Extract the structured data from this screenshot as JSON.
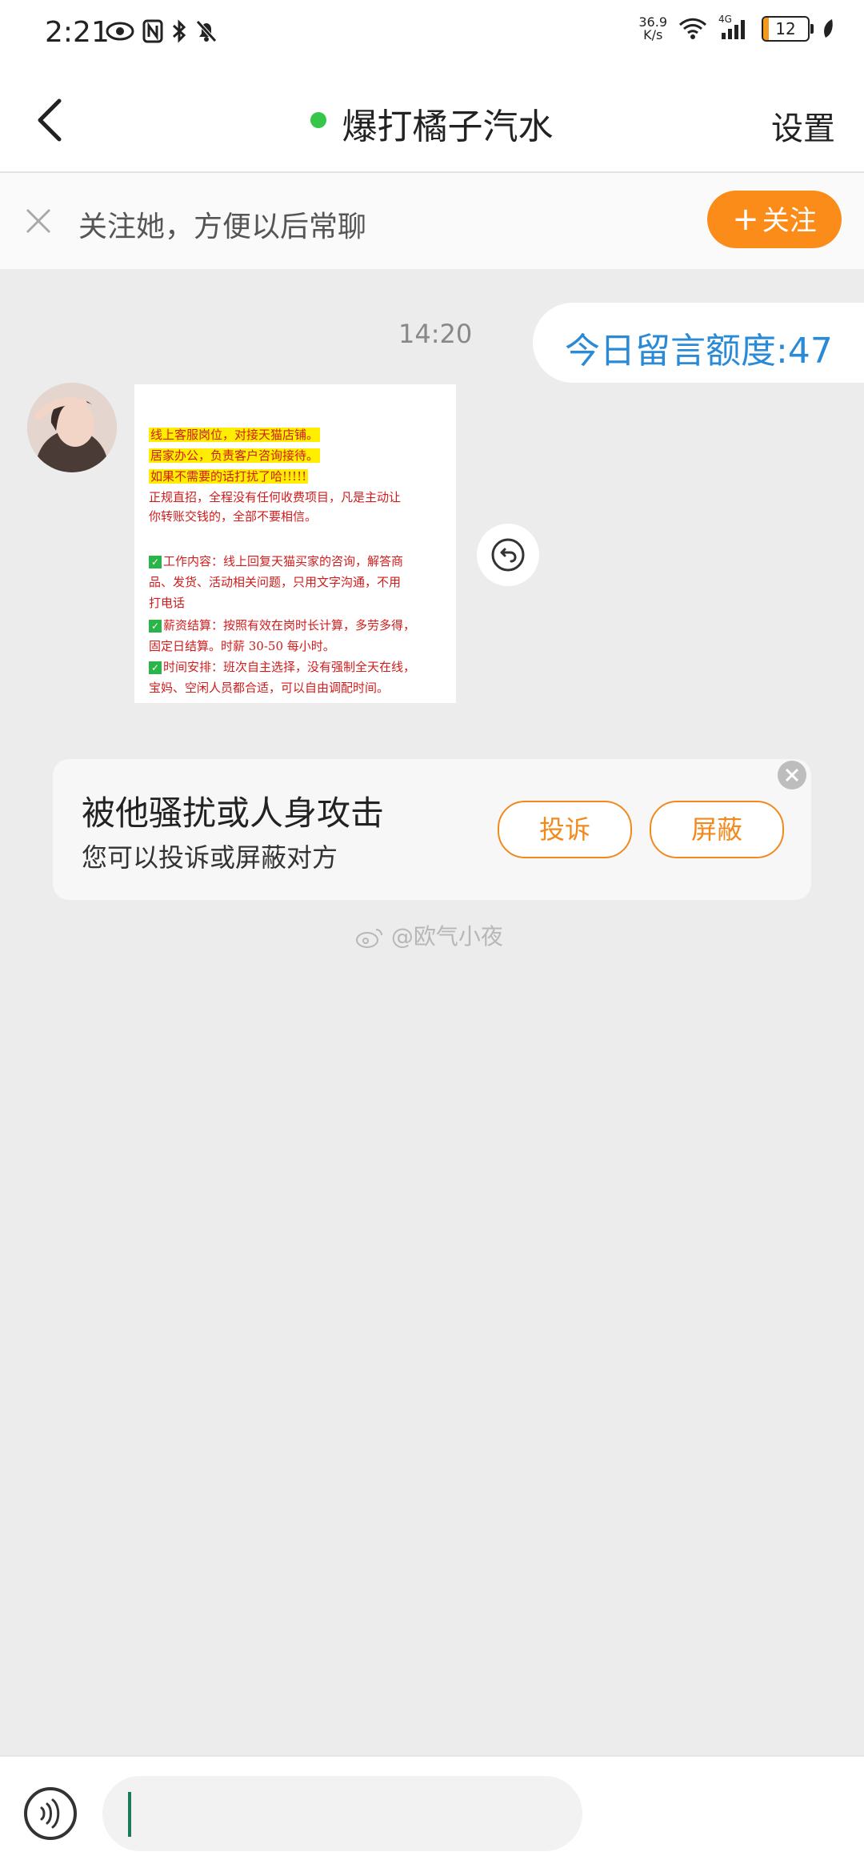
{
  "status_bar": {
    "time": "2:21",
    "net_speed_value": "36.9",
    "net_speed_unit": "K/s",
    "signal_type": "4G",
    "battery_level": "12",
    "battery_color": "#f39a1e"
  },
  "header": {
    "back_icon": "chevron-left-icon",
    "title": "爆打橘子汽水",
    "online_status_color": "#35c64a",
    "settings_label": "设置"
  },
  "follow_banner": {
    "text": "关注她，方便以后常聊",
    "button_plus": "+",
    "button_label": "关注",
    "button_color": "#fc8c1a"
  },
  "chat": {
    "timestamp": "14:20",
    "quota_message": "今日留言额度:47",
    "image_message": {
      "lines": [
        "线上客服岗位，对接天猫店铺。",
        "居家办公，负责客户咨询接待。",
        "如果不需要的话打扰了哈!!!!!",
        "正规直招，全程没有任何收费项目，凡是主动让",
        "你转账交钱的，全部不要相信。",
        "工作内容：线上回复天猫买家的咨询，解答商",
        "品、发货、活动相关问题，只用文字沟通，不用",
        "打电话",
        "薪资结算：按照有效在岗时长计算，多劳多得，",
        "固定日结算。时薪 30-50 每小时。",
        "时间安排：班次自主选择，没有强制全天在线，",
        "宝妈、空闲人员都合适，可以自由调配时间。"
      ]
    }
  },
  "report_card": {
    "title": "被他骚扰或人身攻击",
    "subtitle": "您可以投诉或屏蔽对方",
    "complain_label": "投诉",
    "block_label": "屏蔽"
  },
  "watermark": "@欧气小夜",
  "input_bar": {
    "voice_icon": "voice-icon",
    "input_value": ""
  }
}
